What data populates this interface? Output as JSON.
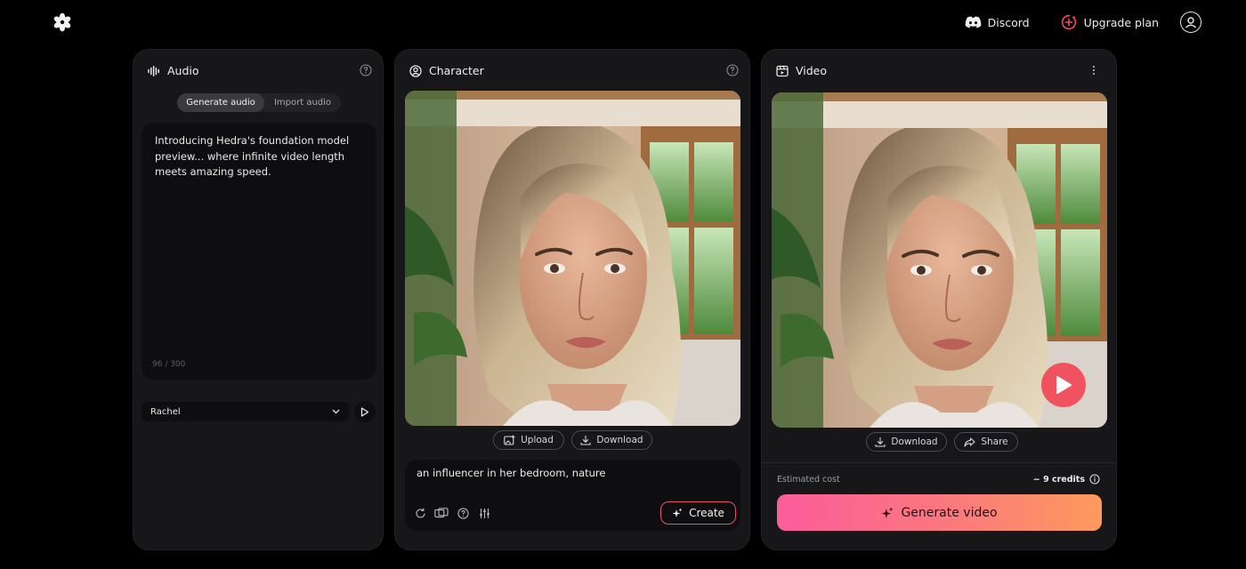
{
  "nav": {
    "discord": "Discord",
    "upgrade": "Upgrade plan"
  },
  "audio": {
    "title": "Audio",
    "tabs": {
      "generate": "Generate audio",
      "import": "Import audio"
    },
    "script_text": "Introducing Hedra's foundation model preview... where infinite video length meets amazing speed.",
    "char_count": "96 / 300",
    "voice": "Rachel"
  },
  "character": {
    "title": "Character",
    "upload": "Upload",
    "download": "Download",
    "prompt": "an influencer in her bedroom, nature",
    "create": "Create"
  },
  "video": {
    "title": "Video",
    "download": "Download",
    "share": "Share",
    "cost_label": "Estimated cost",
    "cost_value": "~ 9 credits",
    "generate": "Generate video"
  },
  "colors": {
    "background": "#000000",
    "panel": "#17171a",
    "accent_pink": "#fb5c9a",
    "accent_orange": "#fd9a5c",
    "play": "#f0535f"
  }
}
